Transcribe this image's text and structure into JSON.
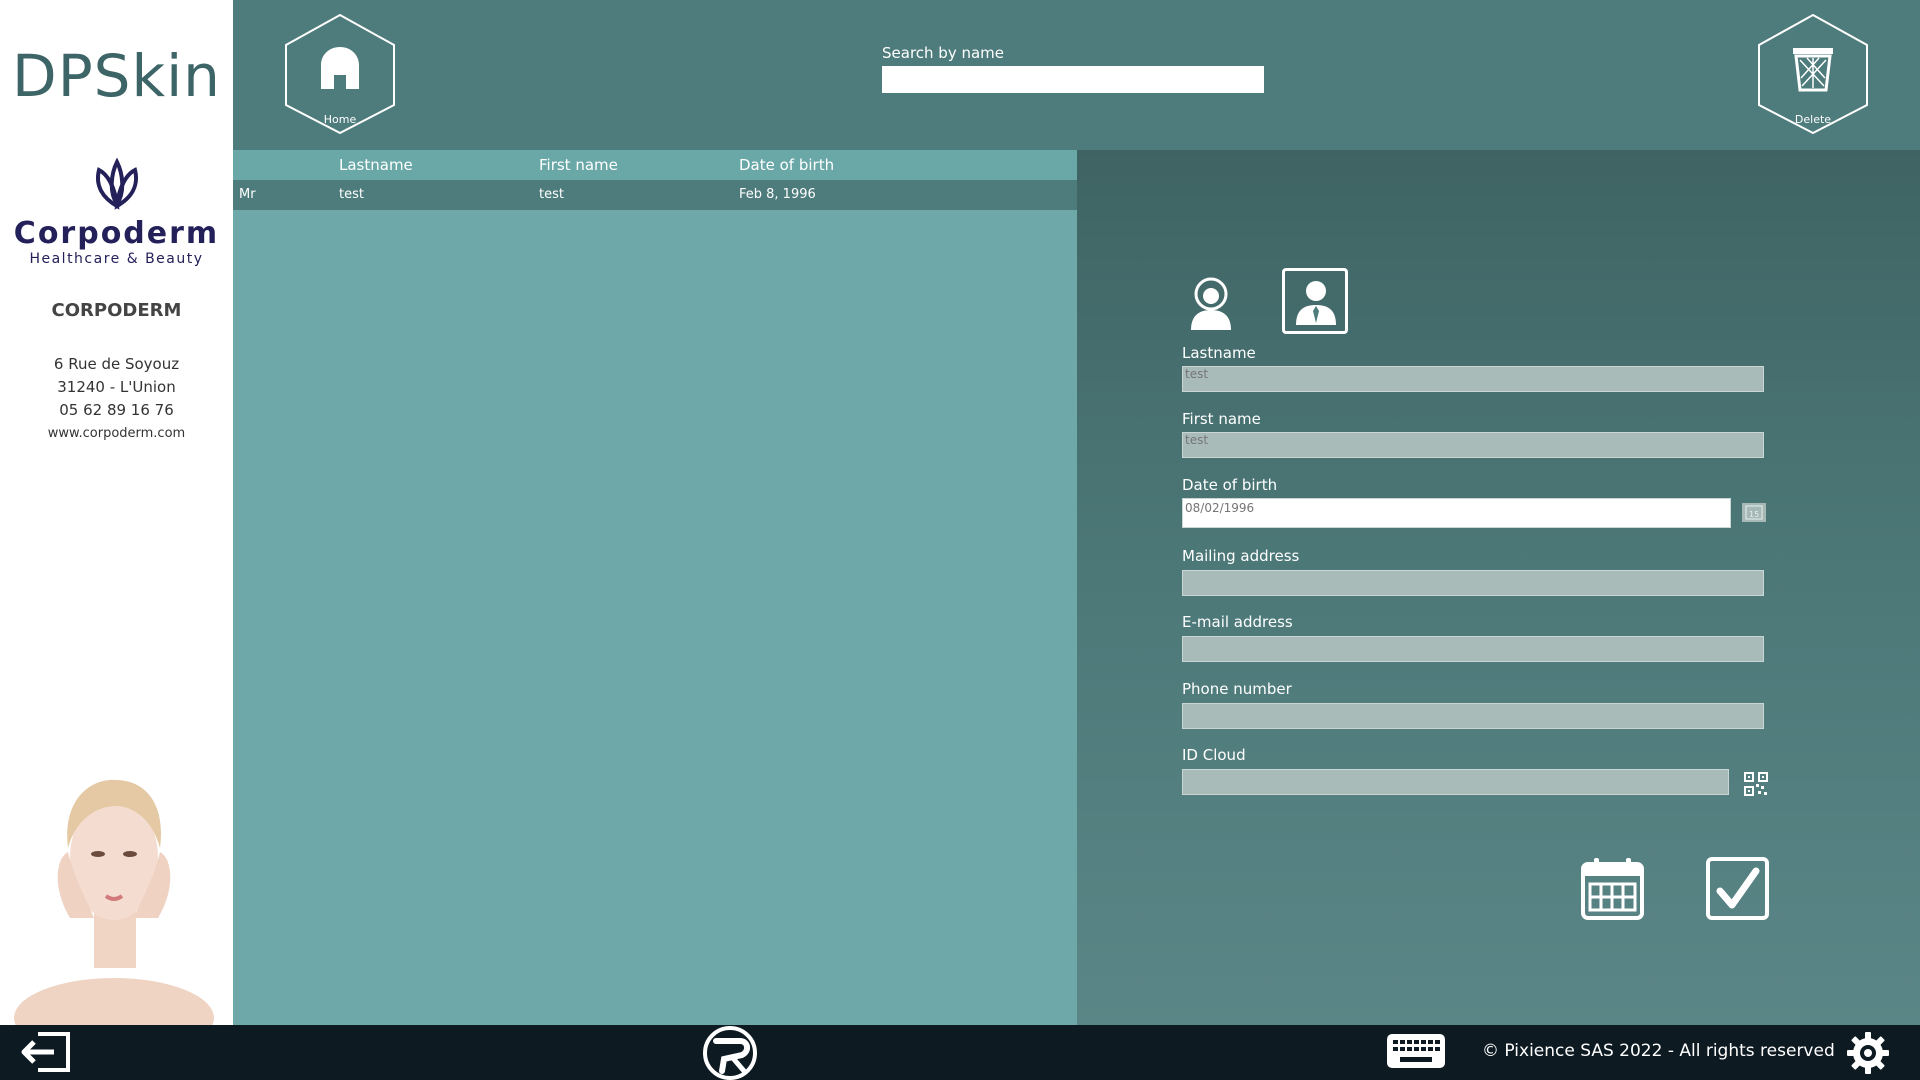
{
  "sidebar": {
    "app_title": "DPSkin",
    "logo_word": "Corpoderm",
    "logo_tagline": "Healthcare & Beauty",
    "company": "CORPODERM",
    "address_line1": "6 Rue de Soyouz",
    "address_line2": "31240  -  L'Union",
    "phone": "05 62 89 16 76",
    "website": "www.corpoderm.com"
  },
  "header": {
    "home_label": "Home",
    "delete_label": "Delete",
    "search_label": "Search by name",
    "search_value": ""
  },
  "table": {
    "columns": [
      "Lastname",
      "First name",
      "Date of birth"
    ],
    "rows": [
      {
        "title": "Mr",
        "lastname": "test",
        "firstname": "test",
        "dob": "Feb 8, 1996"
      }
    ]
  },
  "form": {
    "lastname_label": "Lastname",
    "lastname_value": "test",
    "firstname_label": "First name",
    "firstname_value": "test",
    "dob_label": "Date of birth",
    "dob_value": "08/02/1996",
    "dob_button": "15",
    "mailing_label": "Mailing address",
    "mailing_value": "",
    "email_label": "E-mail address",
    "email_value": "",
    "phone_label": "Phone number",
    "phone_value": "",
    "idcloud_label": "ID Cloud",
    "idcloud_value": "",
    "selected_gender": "male"
  },
  "footer": {
    "copyright": "© Pixience SAS 2022 - All rights reserved"
  },
  "icons": [
    "home-icon",
    "trash-icon",
    "female-user-icon",
    "male-user-icon",
    "calendar-picker-icon",
    "qr-code-icon",
    "calendar-icon",
    "checkmark-icon",
    "logout-icon",
    "pixience-logo-icon",
    "keyboard-icon",
    "gear-icon"
  ],
  "colors": {
    "header_bg": "#4e7b7b",
    "table_bg": "#6fa8a8",
    "form_bg": "#3f6363",
    "footer_bg": "#0d1a22",
    "brand_navy": "#24215a",
    "title_teal": "#3d6466"
  }
}
